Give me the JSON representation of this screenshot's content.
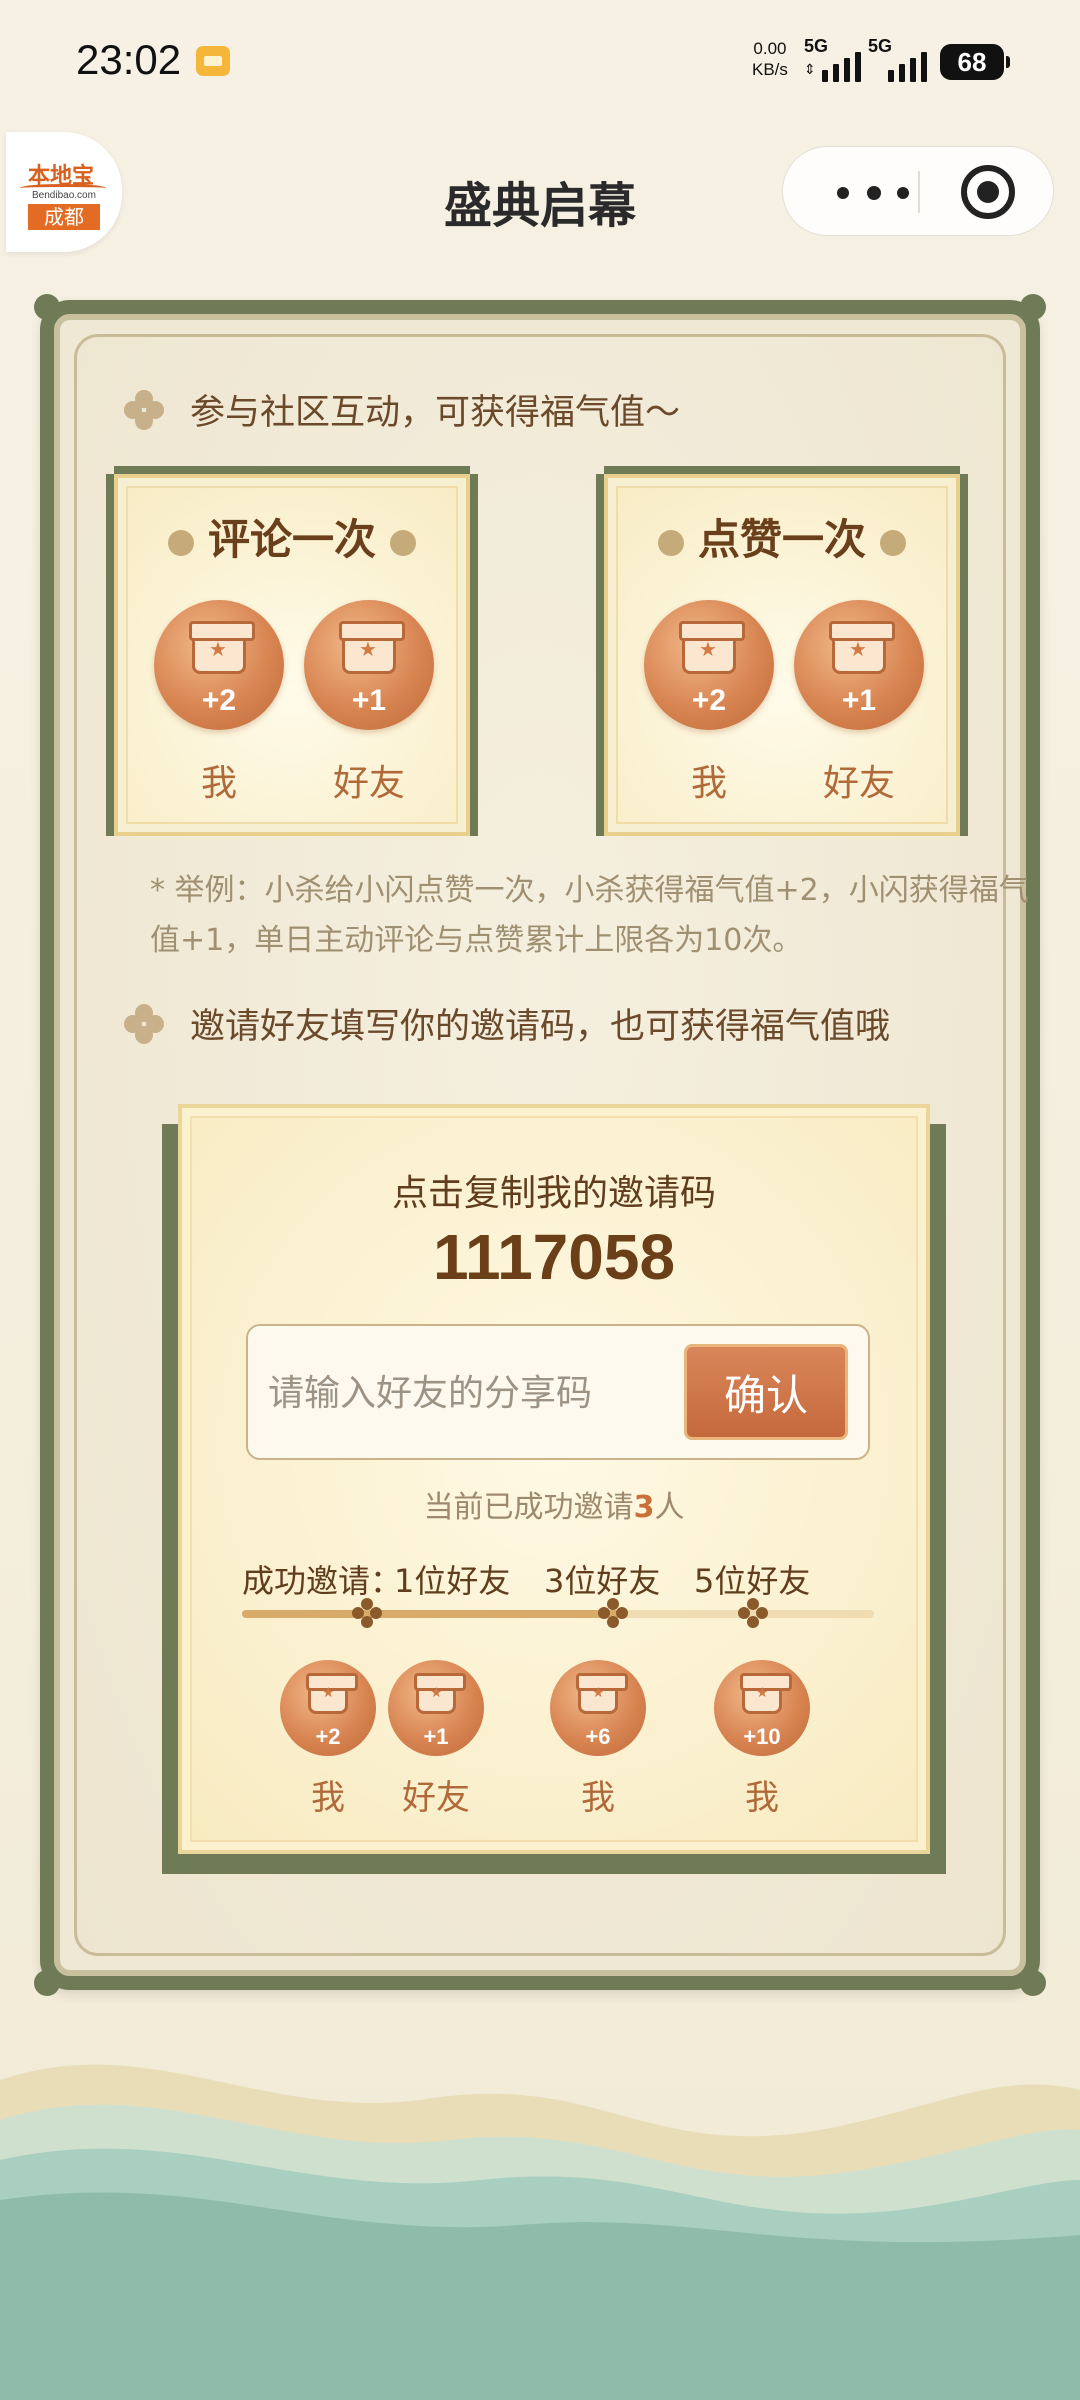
{
  "status_bar": {
    "time": "23:02",
    "speed_value": "0.00",
    "speed_unit": "KB/s",
    "net1": "5G",
    "net2": "5G",
    "battery": "68"
  },
  "nav": {
    "logo_brand": "本地宝",
    "logo_domain": "Bendibao.com",
    "logo_city": "成都",
    "title": "盛典启幕"
  },
  "section1": {
    "heading": "参与社区互动，可获得福气值～",
    "cards": [
      {
        "title": "评论一次",
        "rewards": [
          {
            "value": "+2",
            "label": "我"
          },
          {
            "value": "+1",
            "label": "好友"
          }
        ]
      },
      {
        "title": "点赞一次",
        "rewards": [
          {
            "value": "+2",
            "label": "我"
          },
          {
            "value": "+1",
            "label": "好友"
          }
        ]
      }
    ],
    "note": "* 举例：小杀给小闪点赞一次，小杀获得福气值+2，小闪获得福气值+1，单日主动评论与点赞累计上限各为10次。"
  },
  "section2": {
    "heading": "邀请好友填写你的邀请码，也可获得福气值哦",
    "copy_label": "点击复制我的邀请码",
    "invite_code": "1117058",
    "input_placeholder": "请输入好友的分享码",
    "confirm_label": "确认",
    "invited_prefix": "当前已成功邀请",
    "invited_count": "3",
    "invited_suffix": "人",
    "milestone_label": "成功邀请：",
    "milestones": [
      "1位好友",
      "3位好友",
      "5位好友"
    ],
    "progress_fraction": 0.6,
    "rewards": [
      {
        "value": "+2",
        "label": "我"
      },
      {
        "value": "+1",
        "label": "好友"
      },
      {
        "value": "+6",
        "label": "我"
      },
      {
        "value": "+10",
        "label": "我"
      }
    ]
  },
  "colors": {
    "frame_green": "#6f7b57",
    "accent_orange": "#c96f39",
    "card_gold": "#e8cf8c"
  },
  "icons": [
    "notification-icon",
    "signal-icon",
    "battery-icon",
    "more-icon",
    "close-capsule-icon",
    "clover-icon",
    "gift-box-icon"
  ]
}
